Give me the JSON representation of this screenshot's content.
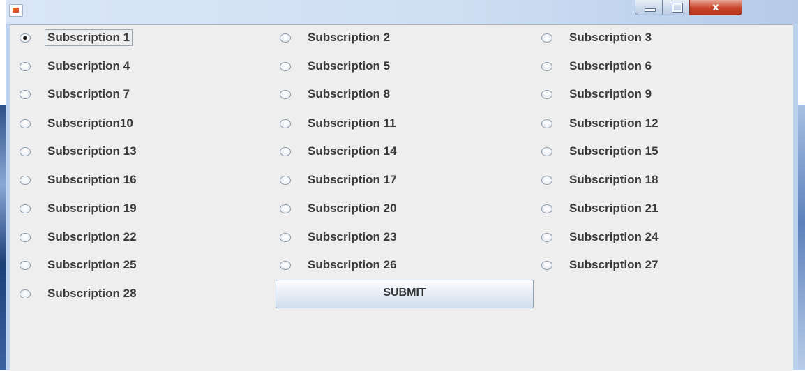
{
  "window": {
    "title": "",
    "close_label": "x"
  },
  "options": [
    {
      "label": "Subscription 1",
      "checked": true,
      "focused": true
    },
    {
      "label": "Subscription 2",
      "checked": false
    },
    {
      "label": "Subscription 3",
      "checked": false
    },
    {
      "label": "Subscription 4",
      "checked": false
    },
    {
      "label": "Subscription 5",
      "checked": false
    },
    {
      "label": "Subscription 6",
      "checked": false
    },
    {
      "label": "Subscription 7",
      "checked": false
    },
    {
      "label": "Subscription 8",
      "checked": false
    },
    {
      "label": "Subscription 9",
      "checked": false
    },
    {
      "label": "Subscription10",
      "checked": false
    },
    {
      "label": "Subscription 11",
      "checked": false
    },
    {
      "label": "Subscription 12",
      "checked": false
    },
    {
      "label": "Subscription 13",
      "checked": false
    },
    {
      "label": "Subscription 14",
      "checked": false
    },
    {
      "label": "Subscription 15",
      "checked": false
    },
    {
      "label": "Subscription 16",
      "checked": false
    },
    {
      "label": "Subscription 17",
      "checked": false
    },
    {
      "label": "Subscription 18",
      "checked": false
    },
    {
      "label": "Subscription 19",
      "checked": false
    },
    {
      "label": "Subscription 20",
      "checked": false
    },
    {
      "label": "Subscription 21",
      "checked": false
    },
    {
      "label": "Subscription 22",
      "checked": false
    },
    {
      "label": "Subscription 23",
      "checked": false
    },
    {
      "label": "Subscription 24",
      "checked": false
    },
    {
      "label": "Subscription 25",
      "checked": false
    },
    {
      "label": "Subscription 26",
      "checked": false
    },
    {
      "label": "Subscription 27",
      "checked": false
    },
    {
      "label": "Subscription 28",
      "checked": false
    }
  ],
  "submit_label": "SUBMIT",
  "colors": {
    "panel_background": "#eeeeee",
    "label_text": "#3a3a3a",
    "close_button": "#c8442a"
  }
}
